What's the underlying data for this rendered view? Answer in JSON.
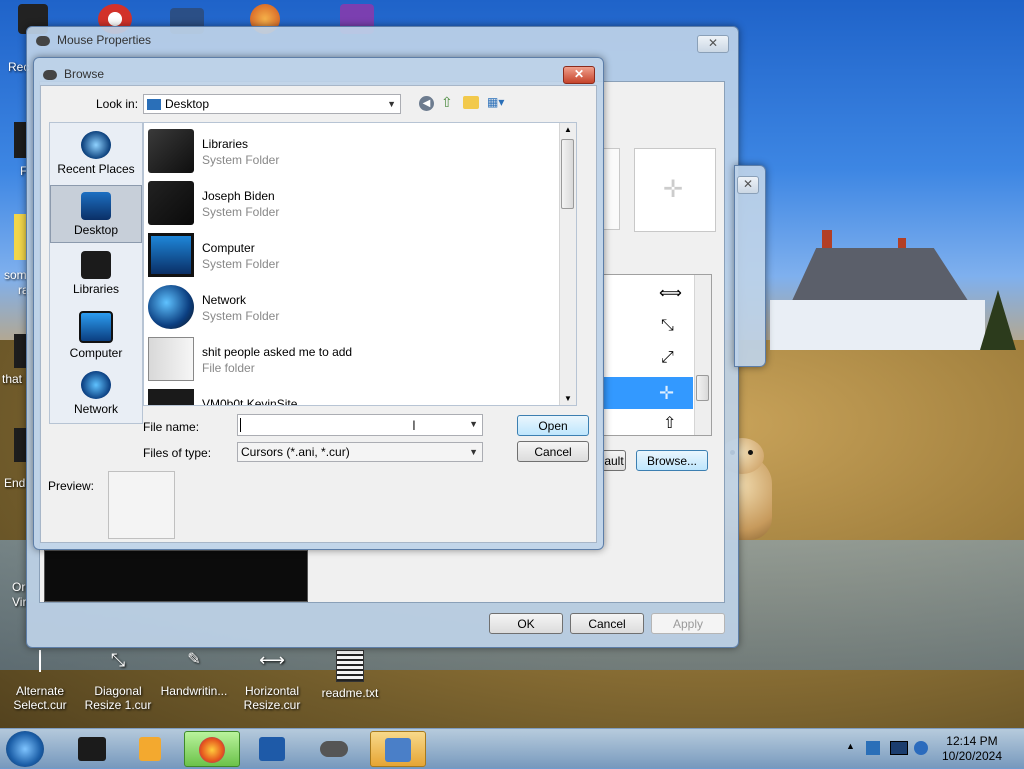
{
  "desktop": {
    "left_edge_labels": [
      "Rec",
      "F",
      "som",
      "ra",
      "that",
      "End",
      "Or",
      "Vir"
    ],
    "bottom_icons": [
      {
        "label_line1": "Alternate",
        "label_line2": "Select.cur"
      },
      {
        "label_line1": "Diagonal",
        "label_line2": "Resize 1.cur"
      },
      {
        "label_line1": "Handwritin..."
      },
      {
        "label_line1": "Horizontal",
        "label_line2": "Resize.cur"
      },
      {
        "label_line1": "readme.txt"
      }
    ]
  },
  "mouse_properties": {
    "title": "Mouse Properties",
    "close": "✕",
    "cursor_glyphs": [
      "⟺",
      "⤡",
      "⤢",
      "✛",
      "⇧"
    ],
    "default_partial": "ault",
    "browse": "Browse...",
    "ok": "OK",
    "cancel": "Cancel",
    "apply": "Apply"
  },
  "browse_dialog": {
    "title": "Browse",
    "close": "✕",
    "look_in_label": "Look in:",
    "look_in_value": "Desktop",
    "places": [
      {
        "label": "Recent Places",
        "selected": false
      },
      {
        "label": "Desktop",
        "selected": true
      },
      {
        "label": "Libraries",
        "selected": false
      },
      {
        "label": "Computer",
        "selected": false
      },
      {
        "label": "Network",
        "selected": false
      }
    ],
    "files": [
      {
        "name": "Libraries",
        "type": "System Folder"
      },
      {
        "name": "Joseph Biden",
        "type": "System Folder"
      },
      {
        "name": "Computer",
        "type": "System Folder"
      },
      {
        "name": "Network",
        "type": "System Folder"
      },
      {
        "name": "shit people asked me to add",
        "type": "File folder"
      },
      {
        "name": "VM0b0t KevinSite",
        "type": ""
      }
    ],
    "file_name_label": "File name:",
    "file_name_value": "",
    "files_of_type_label": "Files of type:",
    "files_of_type_value": "Cursors (*.ani, *.cur)",
    "open": "Open",
    "cancel": "Cancel",
    "preview_label": "Preview:"
  },
  "taskbar": {
    "clock_time": "12:14 PM",
    "clock_date": "10/20/2024"
  }
}
